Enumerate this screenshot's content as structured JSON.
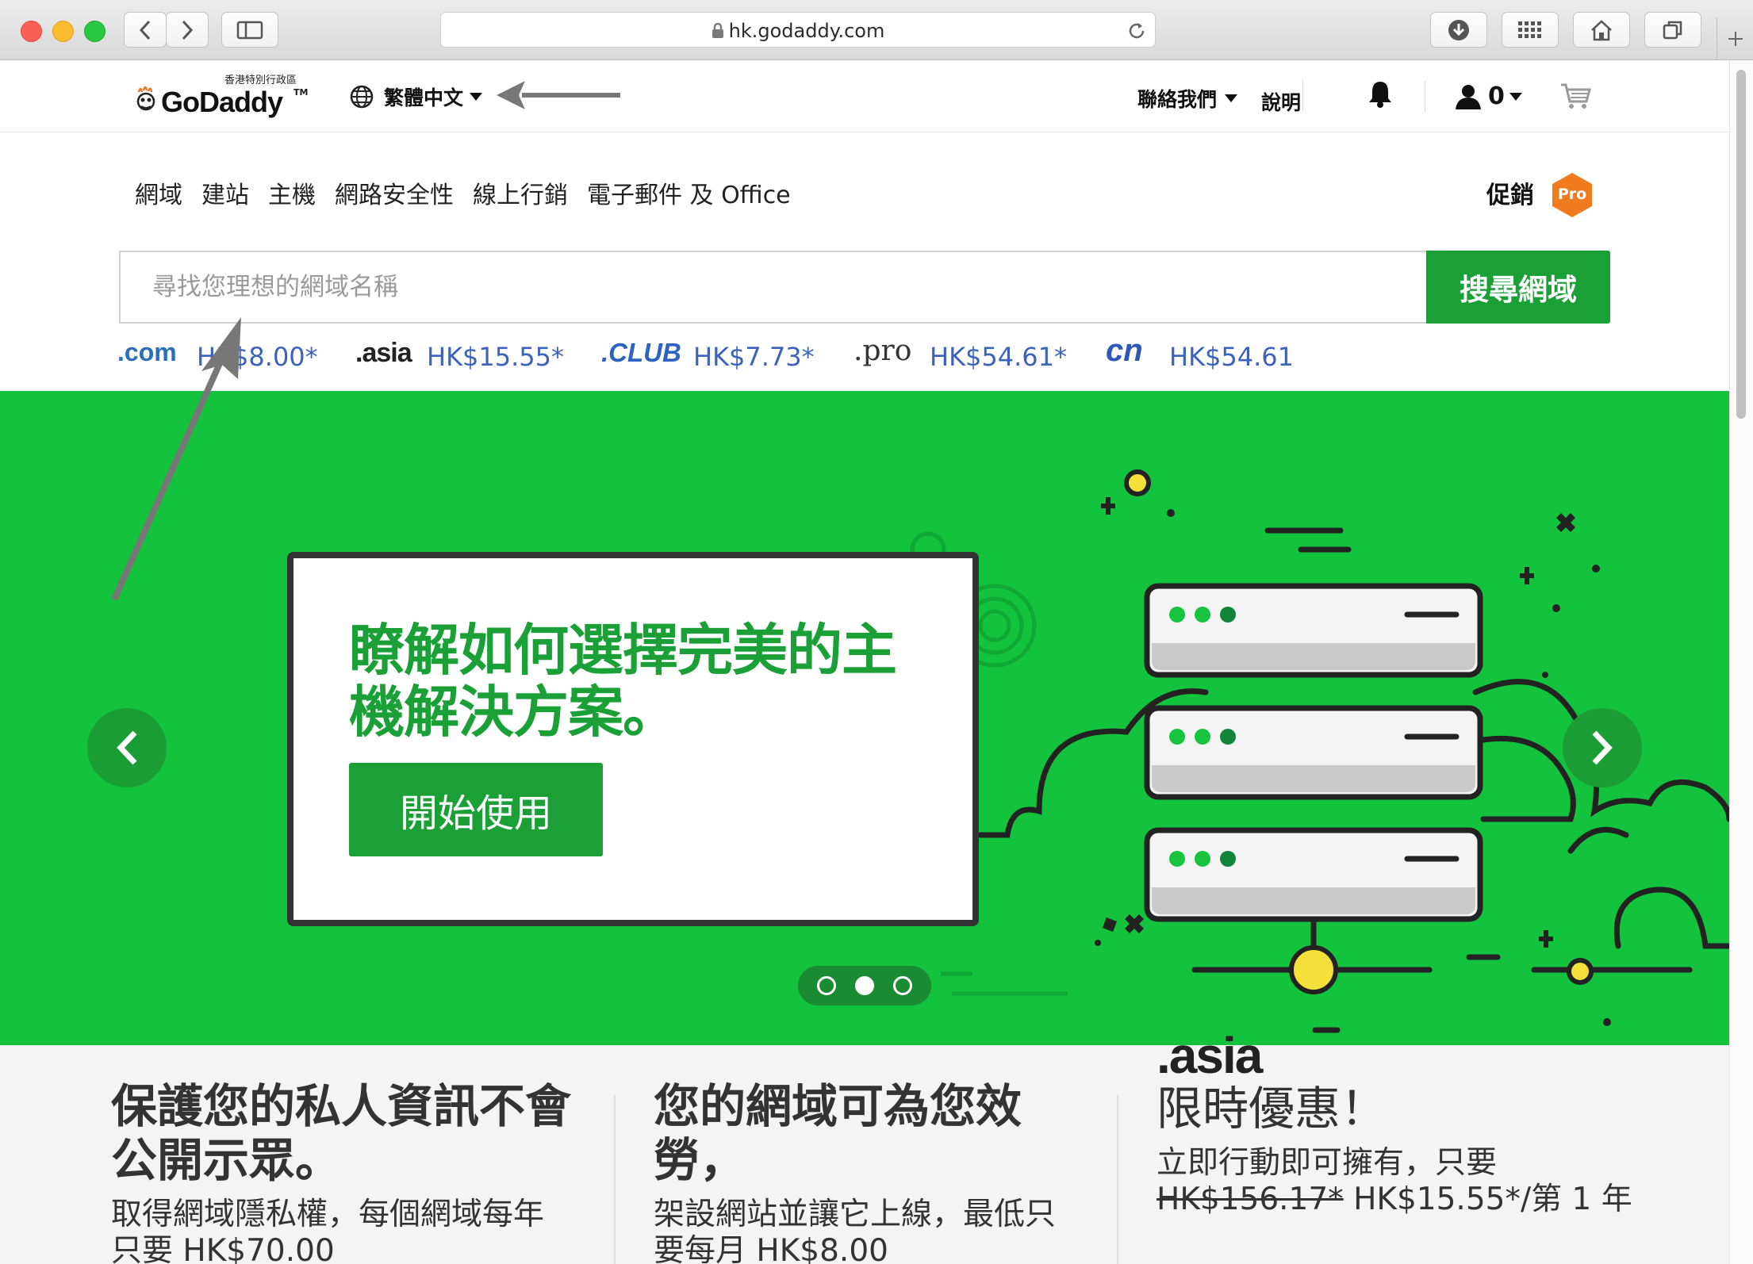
{
  "browser": {
    "url": "hk.godaddy.com"
  },
  "header": {
    "logo_text": "GoDaddy",
    "logo_tm": "TM",
    "logo_region": "香港特別行政區",
    "language_label": "繁體中文",
    "contact_label": "聯絡我們",
    "help_label": "說明",
    "account_count": "0"
  },
  "nav": {
    "items": [
      "網域",
      "建站",
      "主機",
      "網路安全性",
      "線上行銷",
      "電子郵件 及 Office"
    ],
    "promo_label": "促銷",
    "pro_badge": "Pro"
  },
  "search": {
    "placeholder": "尋找您理想的網域名稱",
    "button_label": "搜尋網域"
  },
  "tld_prices": [
    {
      "tld": ".com",
      "price": "HK$8.00*"
    },
    {
      "tld": ".asia",
      "price": "HK$15.55*"
    },
    {
      "tld": ".CLUB",
      "price": "HK$7.73*"
    },
    {
      "tld": ".pro",
      "price": "HK$54.61*"
    },
    {
      "tld": "cn",
      "price": "HK$54.61"
    }
  ],
  "hero": {
    "title": "瞭解如何選擇完美的主機解決方案。",
    "cta_label": "開始使用",
    "slide_count": 3,
    "active_slide": 2,
    "accent_color": "#13c23d",
    "button_color": "#1ba037"
  },
  "features": [
    {
      "title": "保護您的私人資訊不會公開示眾。",
      "body": "取得網域隱私權，每個網域每年只要 HK$70.00"
    },
    {
      "title": "您的網域可為您效勞，",
      "body": "架設網站並讓它上線，最低只要每月 HK$8.00"
    },
    {
      "logo": ".asia",
      "title": "限時優惠！",
      "body": "立即行動即可擁有，只要",
      "old_price": "HK$156.17*",
      "new_price": "HK$15.55*/第 1 年"
    }
  ]
}
